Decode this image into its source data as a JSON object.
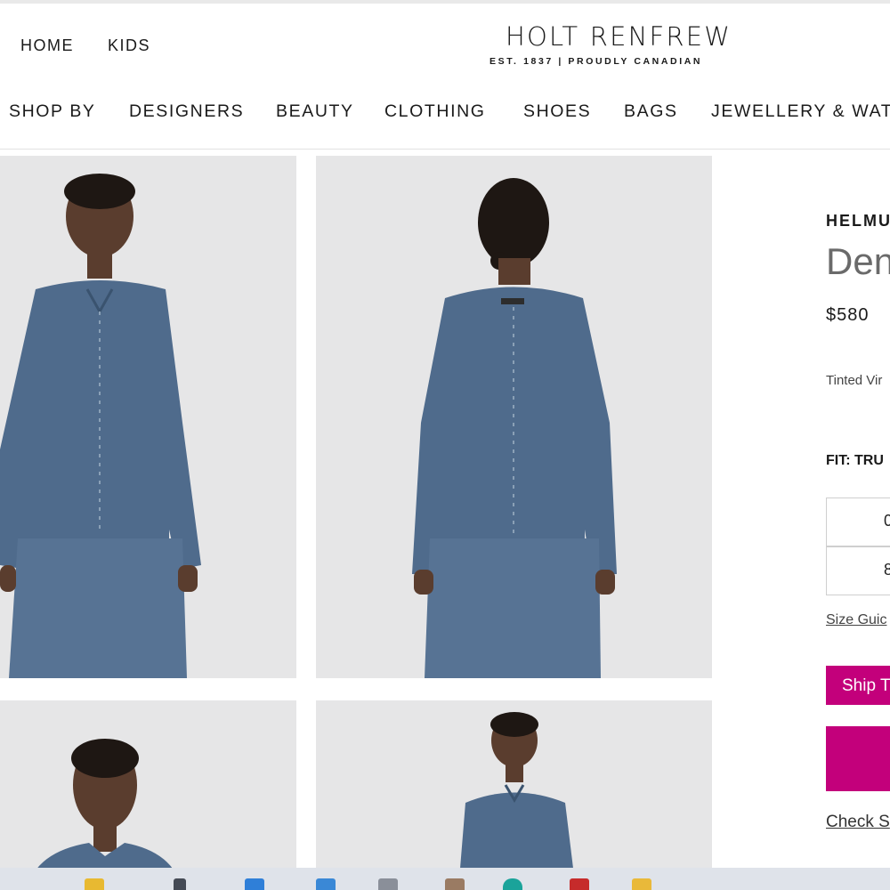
{
  "header": {
    "util_links": [
      "HOME",
      "KIDS"
    ],
    "logo_name": "HOLT RENFREW",
    "logo_tagline": "EST. 1837 | PROUDLY CANADIAN"
  },
  "nav": {
    "items": [
      "SHOP BY",
      "DESIGNERS",
      "BEAUTY",
      "CLOTHING",
      "SHOES",
      "BAGS",
      "JEWELLERY & WATC"
    ]
  },
  "product": {
    "brand": "HELMU",
    "name": "Den",
    "price": "$580",
    "color": "Tinted Vir",
    "fit": "FIT: TRU",
    "sizes": [
      "0",
      "8"
    ],
    "size_guide": "Size Guic",
    "ship_button": "Ship T",
    "check_link": "Check S"
  },
  "colors": {
    "accent": "#c3007b",
    "photo_bg": "#e6e6e7",
    "denim": "#4f6b8c"
  },
  "taskbar": {
    "icons": [
      "widgets-icon",
      "chat-icon",
      "browser-icon",
      "mail-icon",
      "files-icon",
      "app-icon",
      "edge-icon",
      "office-icon",
      "folder-icon"
    ]
  }
}
